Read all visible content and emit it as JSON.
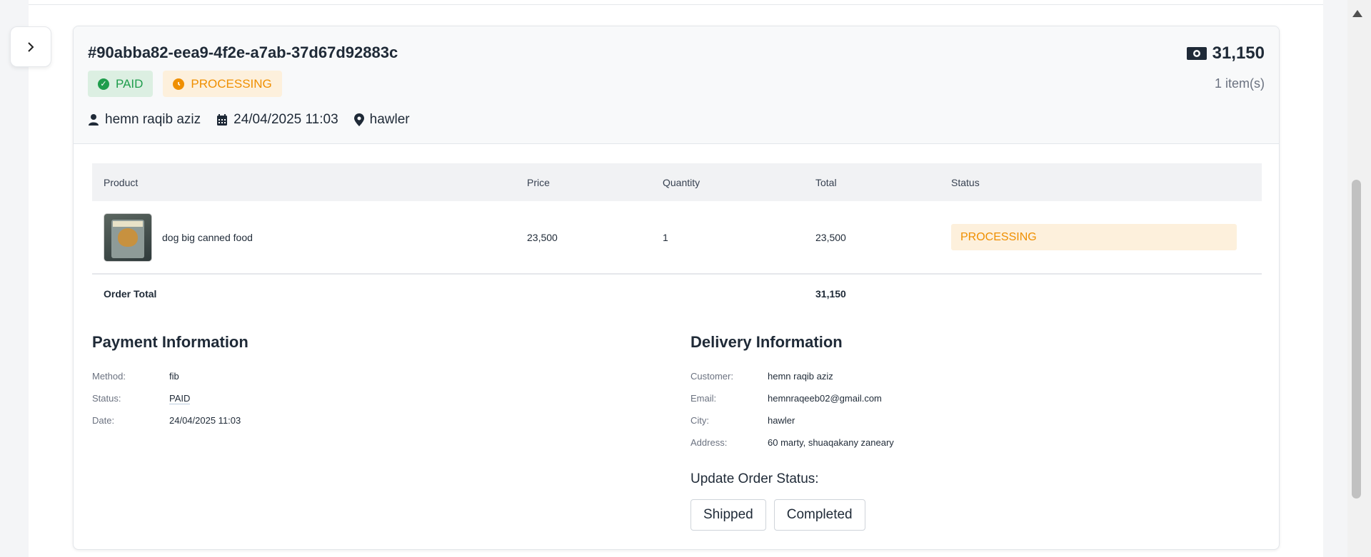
{
  "order": {
    "id": "#90abba82-eea9-4f2e-a7ab-37d67d92883c",
    "payment_badge": "PAID",
    "status_badge": "PROCESSING",
    "customer": "hemn raqib aziz",
    "datetime": "24/04/2025 11:03",
    "city": "hawler",
    "amount": "31,150",
    "items_count": "1 item(s)"
  },
  "table": {
    "headers": {
      "product": "Product",
      "price": "Price",
      "quantity": "Quantity",
      "total": "Total",
      "status": "Status"
    },
    "rows": [
      {
        "product": "dog big canned food",
        "price": "23,500",
        "quantity": "1",
        "total": "23,500",
        "status": "PROCESSING"
      }
    ],
    "footer": {
      "label": "Order Total",
      "total": "31,150"
    }
  },
  "payment": {
    "title": "Payment Information",
    "method_label": "Method:",
    "method": "fib",
    "status_label": "Status:",
    "status": "PAID",
    "date_label": "Date:",
    "date": "24/04/2025 11:03"
  },
  "delivery": {
    "title": "Delivery Information",
    "customer_label": "Customer:",
    "customer": "hemn raqib aziz",
    "email_label": "Email:",
    "email": "hemnraqeeb02@gmail.com",
    "city_label": "City:",
    "city": "hawler",
    "address_label": "Address:",
    "address": "60 marty, shuaqakany zaneary"
  },
  "update": {
    "label": "Update Order Status:",
    "shipped": "Shipped",
    "completed": "Completed"
  },
  "colors": {
    "paid": "#1f9d4c",
    "processing": "#ef8f00",
    "text": "#1f2a37"
  }
}
